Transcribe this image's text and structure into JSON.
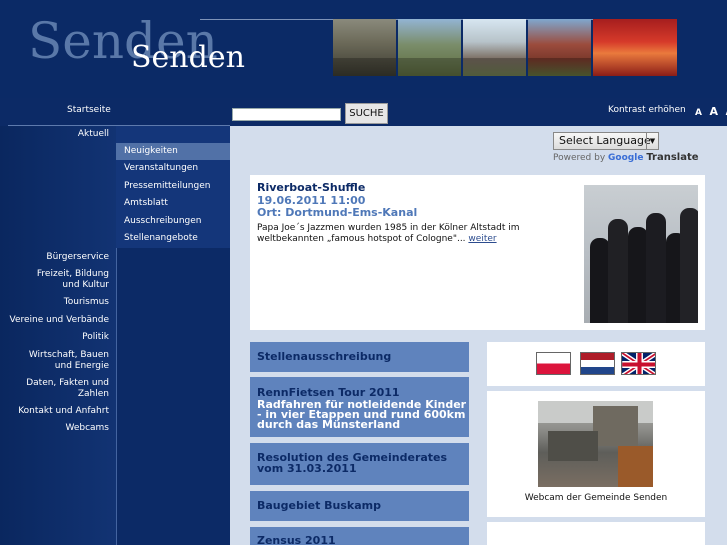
{
  "header": {
    "logo_ghost": "Senden",
    "logo_text": "Senden"
  },
  "topnav": {
    "startseite": "Startseite",
    "search_button": "SUCHE",
    "search_value": "",
    "kontrast": "Kontrast erhöhen",
    "font_sizes": [
      "A",
      "A",
      "A"
    ]
  },
  "leftnav": {
    "aktuell": "Aktuell",
    "sub_items": [
      "Neuigkeiten",
      "Veranstaltungen",
      "Pressemitteilungen",
      "Amtsblatt",
      "Ausschreibungen",
      "Stellenangebote"
    ],
    "items": [
      "Bürgerservice",
      "Freizeit, Bildung und Kultur",
      "Tourismus",
      "Vereine und Verbände",
      "Politik",
      "Wirtschaft, Bauen und Energie",
      "Daten, Fakten und Zahlen",
      "Kontakt und Anfahrt",
      "Webcams"
    ]
  },
  "translate": {
    "select_label": "Select Language",
    "powered_by": "Powered by",
    "google": "Google",
    "translate": "Translate"
  },
  "news": {
    "title": "Riverboat-Shuffle",
    "date": "19.06.2011 11:00",
    "place": "Ort: Dortmund-Ems-Kanal",
    "text": "Papa Joe´s Jazzmen wurden 1985 in der Kölner Altstadt im weltbekannten „famous hotspot of Cologne\"...",
    "more": "weiter"
  },
  "list": [
    {
      "title": "Stellenausschreibung"
    },
    {
      "title": "RennFietsen Tour 2011",
      "subtitle": "Radfahren für notleidende Kinder - in vier Etappen und rund 600km durch das Münsterland"
    },
    {
      "title": "Resolution des Gemeinderates vom 31.03.2011"
    },
    {
      "title": "Baugebiet Buskamp"
    },
    {
      "title": "Zensus 2011"
    }
  ],
  "webcam": {
    "caption": "Webcam der Gemeinde Senden"
  },
  "colors": {
    "background": "#0c2a66",
    "content_bg": "#d3ddec",
    "list_item": "#5f83bd",
    "active_sub": "#5171a7"
  }
}
